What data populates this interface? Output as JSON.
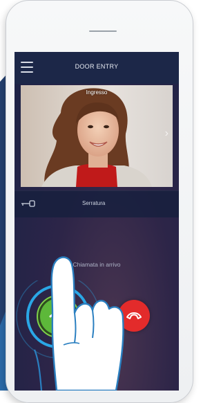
{
  "header": {
    "menu_icon": "hamburger-menu-icon",
    "title": "DOOR ENTRY"
  },
  "video": {
    "source_label": "Ingresso",
    "next_icon": "chevron-right-icon"
  },
  "lock": {
    "icon": "key-icon",
    "label": "Serratura"
  },
  "call": {
    "status_text": "Chiamata in arrivo",
    "answer_icon": "phone-answer-icon",
    "hangup_icon": "phone-hangup-icon"
  },
  "colors": {
    "screen_top": "#1c2748",
    "answer_green": "#5db83a",
    "answer_ring": "#2aa7e6",
    "hangup_red": "#e32b2b"
  }
}
